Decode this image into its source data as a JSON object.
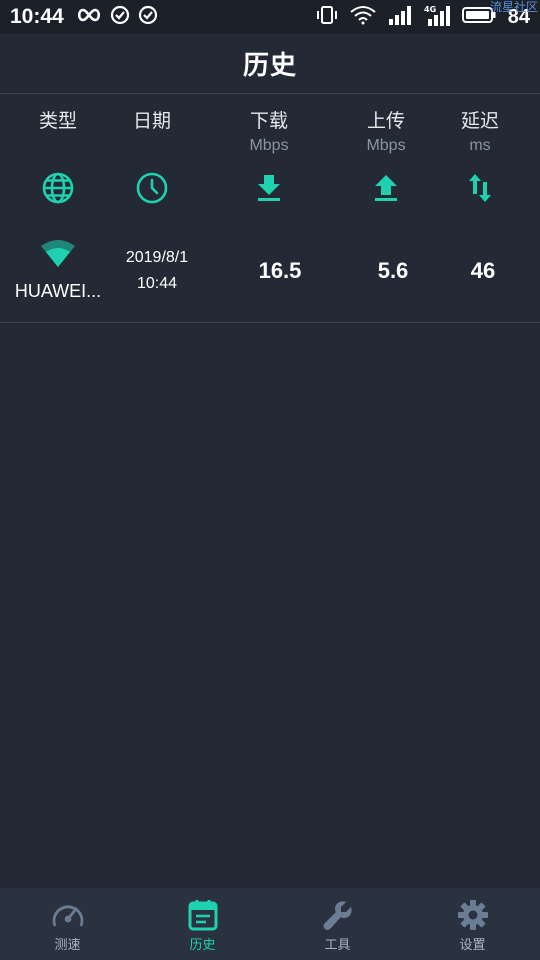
{
  "status_bar": {
    "time": "10:44",
    "battery": "84",
    "watermark": "流星社区"
  },
  "header": {
    "title": "历史"
  },
  "columns": [
    {
      "title": "类型",
      "unit": "",
      "icon": "globe-icon"
    },
    {
      "title": "日期",
      "unit": "",
      "icon": "clock-icon"
    },
    {
      "title": "下载",
      "unit": "Mbps",
      "icon": "download-icon"
    },
    {
      "title": "上传",
      "unit": "Mbps",
      "icon": "upload-icon"
    },
    {
      "title": "延迟",
      "unit": "ms",
      "icon": "latency-icon"
    }
  ],
  "history": [
    {
      "network_icon": "wifi-icon",
      "network_name": "HUAWEI...",
      "date": "2019/8/1",
      "time": "10:44",
      "download": "16.5",
      "upload": "5.6",
      "latency": "46"
    }
  ],
  "nav": [
    {
      "label": "测速",
      "icon": "speedometer-icon",
      "active": false
    },
    {
      "label": "历史",
      "icon": "history-icon",
      "active": true
    },
    {
      "label": "工具",
      "icon": "wrench-icon",
      "active": false
    },
    {
      "label": "设置",
      "icon": "gear-icon",
      "active": false
    }
  ],
  "colors": {
    "accent": "#1fd1b0",
    "background": "#232a35",
    "nav_inactive": "#6b7c95"
  }
}
